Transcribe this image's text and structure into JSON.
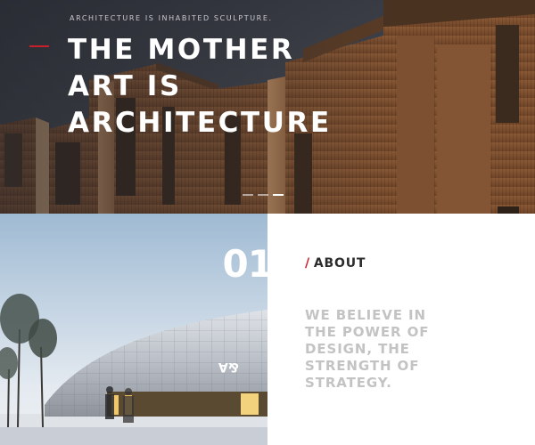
{
  "hero": {
    "tagline": "ARCHITECTURE IS INHABITED SCULPTURE.",
    "headline_lines": [
      "THE MOTHER",
      "ART IS",
      "ARCHITECTURE"
    ],
    "slider": {
      "slide_count": 3,
      "active_index": 2
    },
    "accent_color": "#c8202a"
  },
  "section": {
    "number": "01"
  },
  "about": {
    "slash": "/",
    "title": "ABOUT",
    "statement_lines": [
      "WE BELIEVE IN",
      "THE POWER OF",
      "DESIGN, THE",
      "STRENGTH OF",
      "STRATEGY."
    ]
  },
  "photo": {
    "building_sign": "&A"
  }
}
